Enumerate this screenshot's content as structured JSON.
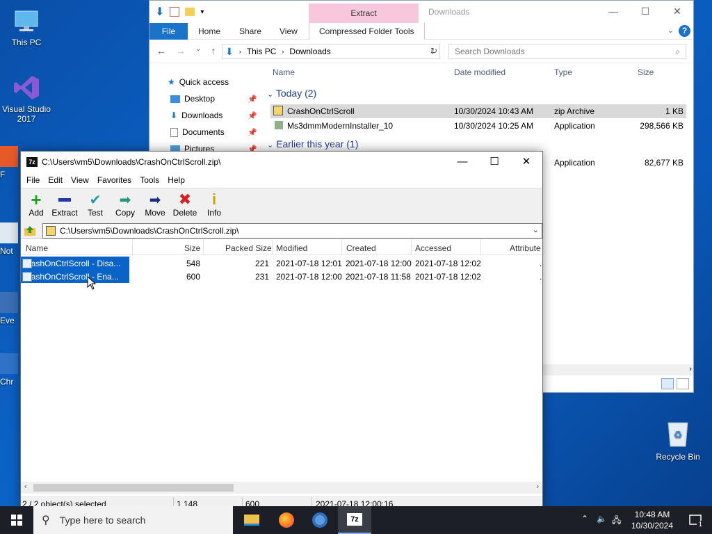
{
  "desktop": {
    "icons": [
      {
        "label": "This PC"
      },
      {
        "label": "Visual Studio 2017"
      }
    ],
    "partial_labels": [
      "F",
      "Not",
      "Eve",
      "Chr"
    ],
    "recycle_bin": "Recycle Bin"
  },
  "explorer": {
    "title": "Downloads",
    "context_tab": "Extract",
    "tabs": [
      "File",
      "Home",
      "Share",
      "View",
      "Compressed Folder Tools"
    ],
    "address": {
      "segments": [
        "This PC",
        "Downloads"
      ]
    },
    "search_placeholder": "Search Downloads",
    "nav_items": [
      {
        "label": "Quick access"
      },
      {
        "label": "Desktop"
      },
      {
        "label": "Downloads"
      },
      {
        "label": "Documents"
      },
      {
        "label": "Pictures"
      }
    ],
    "columns": [
      "Name",
      "Date modified",
      "Type",
      "Size"
    ],
    "groups": {
      "today": "Today (2)",
      "earlier": "Earlier this year (1)"
    },
    "files": [
      {
        "name": "CrashOnCtrlScroll",
        "date": "10/30/2024 10:43 AM",
        "type": "zip Archive",
        "size": "1 KB"
      },
      {
        "name": "Ms3dmmModernInstaller_10",
        "date": "10/30/2024 10:25 AM",
        "type": "Application",
        "size": "298,566 KB"
      },
      {
        "name": "",
        "date": "",
        "type": "Application",
        "size": "82,677 KB"
      }
    ]
  },
  "sevenzip": {
    "title": "C:\\Users\\vm5\\Downloads\\CrashOnCtrlScroll.zip\\",
    "menu": [
      "File",
      "Edit",
      "View",
      "Favorites",
      "Tools",
      "Help"
    ],
    "toolbar": [
      "Add",
      "Extract",
      "Test",
      "Copy",
      "Move",
      "Delete",
      "Info"
    ],
    "path": "C:\\Users\\vm5\\Downloads\\CrashOnCtrlScroll.zip\\",
    "columns": [
      "Name",
      "Size",
      "Packed Size",
      "Modified",
      "Created",
      "Accessed",
      "Attribute"
    ],
    "rows": [
      {
        "name": "CrashOnCtrlScroll - Disa...",
        "size": "548",
        "packed": "221",
        "modified": "2021-07-18 12:01",
        "created": "2021-07-18 12:00",
        "accessed": "2021-07-18 12:02",
        "attr": "."
      },
      {
        "name": "CrashOnCtrlScroll - Ena...",
        "size": "600",
        "packed": "231",
        "modified": "2021-07-18 12:00",
        "created": "2021-07-18 11:58",
        "accessed": "2021-07-18 12:02",
        "attr": "."
      }
    ],
    "status": {
      "selected": "2 / 2 object(s) selected",
      "size": "1 148",
      "packed": "600",
      "date": "2021-07-18 12:00:16"
    }
  },
  "taskbar": {
    "search_placeholder": "Type here to search",
    "time": "10:48 AM",
    "date": "10/30/2024",
    "notification_count": "1"
  }
}
